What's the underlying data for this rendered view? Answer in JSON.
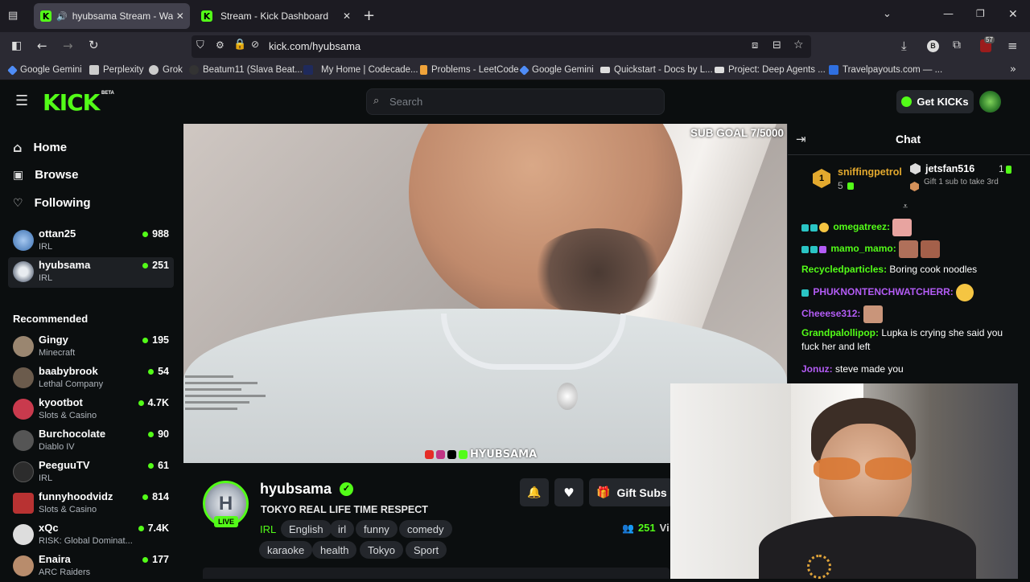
{
  "browser": {
    "tabs": [
      {
        "title": "hyubsama Stream - Watch Live",
        "close": "✕"
      },
      {
        "title": "Stream - Kick Dashboard",
        "close": "✕"
      }
    ],
    "new_tab": "+",
    "url": "kick.com/hyubsama",
    "notif_count": "57",
    "bookmarks": [
      {
        "label": "Google Gemini",
        "color": "#4f8df7"
      },
      {
        "label": "Perplexity",
        "color": "#dddddd"
      },
      {
        "label": "Grok",
        "color": "#dddddd"
      },
      {
        "label": "Beatum11 (Slava Beat...",
        "color": "#333333"
      },
      {
        "label": "My Home | Codecade...",
        "color": "#1f2a5c"
      },
      {
        "label": "Problems - LeetCode",
        "color": "#f0a33a"
      },
      {
        "label": "Google Gemini",
        "color": "#4f8df7"
      },
      {
        "label": "Quickstart - Docs by L...",
        "color": "#dddddd"
      },
      {
        "label": "Project: Deep Agents ...",
        "color": "#dddddd"
      },
      {
        "label": "Travelpayouts.com — ...",
        "color": "#2f6fe0"
      }
    ]
  },
  "header": {
    "logo": "KICK",
    "logo_beta": "BETA",
    "search_placeholder": "Search",
    "get_kicks": "Get KICKs"
  },
  "sidebar": {
    "nav": [
      {
        "label": "Home",
        "icon": "home-icon"
      },
      {
        "label": "Browse",
        "icon": "browse-icon"
      },
      {
        "label": "Following",
        "icon": "heart-icon"
      }
    ],
    "following": [
      {
        "name": "ottan25",
        "category": "IRL",
        "viewers": "988",
        "color": "#5a8ed8"
      },
      {
        "name": "hyubsama",
        "category": "IRL",
        "viewers": "251",
        "color": "#8b93a0"
      }
    ],
    "recommended_title": "Recommended",
    "recommended": [
      {
        "name": "Gingy",
        "category": "Minecraft",
        "viewers": "195",
        "color": "#9a8670"
      },
      {
        "name": "baabybrook",
        "category": "Lethal Company",
        "viewers": "54",
        "color": "#6b5b4c"
      },
      {
        "name": "kyootbot",
        "category": "Slots & Casino",
        "viewers": "4.7K",
        "color": "#c93a4d"
      },
      {
        "name": "Burchocolate",
        "category": "Diablo IV",
        "viewers": "90",
        "color": "#444444"
      },
      {
        "name": "PeeguuTV",
        "category": "IRL",
        "viewers": "61",
        "color": "#2c2c2c"
      },
      {
        "name": "funnyhoodvidz",
        "category": "Slots & Casino",
        "viewers": "814",
        "color": "#b83232"
      },
      {
        "name": "xQc",
        "category": "RISK: Global Dominat...",
        "viewers": "7.4K",
        "color": "#dddddd"
      },
      {
        "name": "Enaira",
        "category": "ARC Raiders",
        "viewers": "177",
        "color": "#b88c6c"
      }
    ]
  },
  "video": {
    "sub_goal": "SUB GOAL 7/5000",
    "watermark": "HYUBSAMA"
  },
  "stream": {
    "name": "hyubsama",
    "title": "TOKYO REAL LIFE TIME RESPECT",
    "live": "LIVE",
    "category": "IRL",
    "tags_row1": [
      "English",
      "irl",
      "funny",
      "comedy"
    ],
    "tags_row2": [
      "karaoke",
      "health",
      "Tokyo",
      "Sport"
    ],
    "gift_subs": "Gift Subs",
    "viewers": "251",
    "viewers_suffix": "Vi"
  },
  "chat": {
    "title": "Chat",
    "leaderboard": [
      {
        "rank": "1",
        "name": "sniffingpetrol",
        "count": "5"
      },
      {
        "rank": "",
        "name": "jetsfan516",
        "count": "1"
      }
    ],
    "gift_hint": "Gift 1 sub to take 3rd",
    "messages": [
      {
        "user": "omegatreez",
        "color": "#53fc18",
        "text": ""
      },
      {
        "user": "mamo_mamo",
        "color": "#53fc18",
        "text": ""
      },
      {
        "user": "Recycledparticles",
        "color": "#53fc18",
        "text": "Boring cook noodles"
      },
      {
        "user": "PHUKNONTENCHWATCHERR",
        "color": "#b35cf5",
        "text": ""
      },
      {
        "user": "Cheeese312",
        "color": "#b35cf5",
        "text": ""
      },
      {
        "user": "Grandpalollipop",
        "color": "#53fc18",
        "text": "Lupka is crying she said you fuck her and left"
      },
      {
        "user": "Jonuz",
        "color": "#b35cf5",
        "text": "steve made you"
      }
    ]
  }
}
